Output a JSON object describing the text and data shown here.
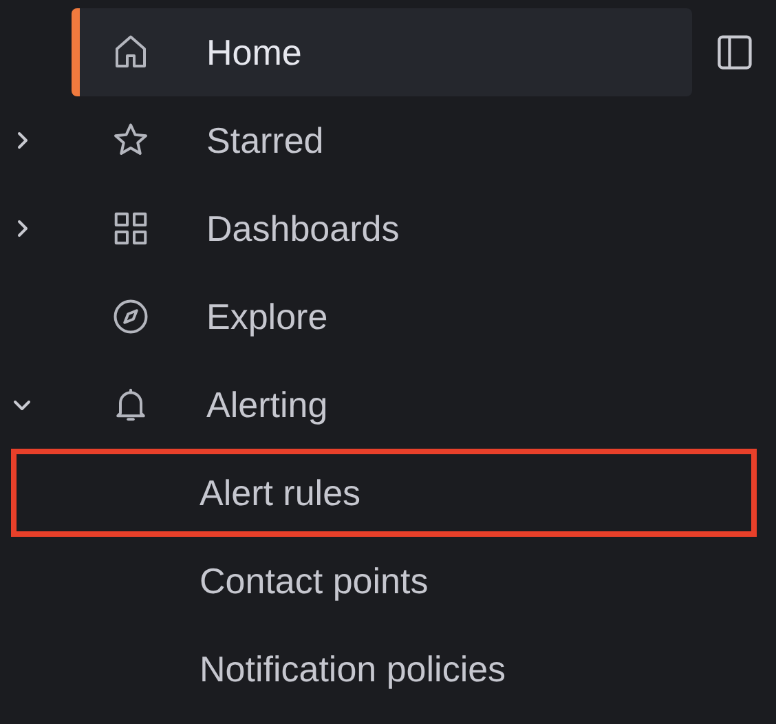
{
  "sidebar": {
    "items": [
      {
        "label": "Home",
        "selected": true
      },
      {
        "label": "Starred",
        "selected": false,
        "expanded": false
      },
      {
        "label": "Dashboards",
        "selected": false,
        "expanded": false
      },
      {
        "label": "Explore",
        "selected": false
      },
      {
        "label": "Alerting",
        "selected": false,
        "expanded": true,
        "children": [
          {
            "label": "Alert rules",
            "highlighted": true
          },
          {
            "label": "Contact points",
            "highlighted": false
          },
          {
            "label": "Notification policies",
            "highlighted": false
          }
        ]
      }
    ]
  }
}
